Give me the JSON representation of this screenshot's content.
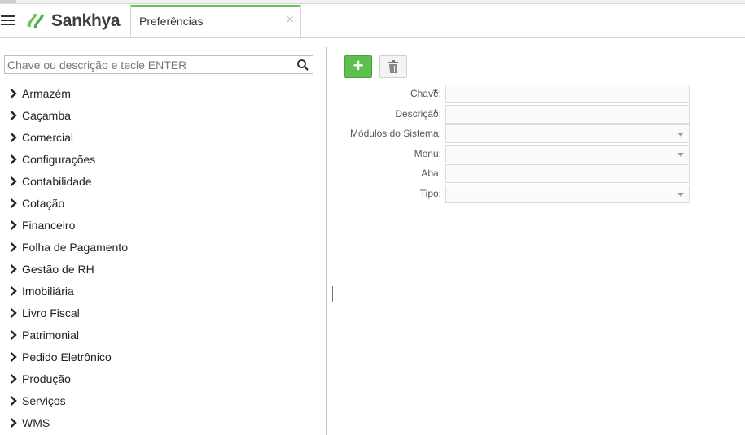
{
  "header": {
    "brand": "Sankhya",
    "tab_title": "Preferências",
    "tab_close": "×"
  },
  "search": {
    "placeholder": "Chave ou descrição e tecle ENTER"
  },
  "tree": [
    "Armazém",
    "Caçamba",
    "Comercial",
    "Configurações",
    "Contabilidade",
    "Cotação",
    "Financeiro",
    "Folha de Pagamento",
    "Gestão de RH",
    "Imobiliária",
    "Livro Fiscal",
    "Patrimonial",
    "Pedido Eletrônico",
    "Produção",
    "Serviços",
    "WMS"
  ],
  "toolbar": {
    "add_label": "+"
  },
  "form": {
    "chave": {
      "label": "Chave:",
      "required": "*"
    },
    "descricao": {
      "label": "Descrição:",
      "required": "*"
    },
    "modulos": {
      "label": "Módulos do Sistema:"
    },
    "menu": {
      "label": "Menu:"
    },
    "aba": {
      "label": "Aba:"
    },
    "tipo": {
      "label": "Tipo:"
    }
  },
  "colors": {
    "accent": "#6cc35c",
    "add_button": "#5cbf4e"
  },
  "icons": {
    "menu": "hamburger-menu-icon",
    "logo": "sankhya-logo-icon",
    "search": "search-icon",
    "chevron": "chevron-right-icon",
    "delete": "trash-icon",
    "dropdown": "caret-down-icon"
  }
}
